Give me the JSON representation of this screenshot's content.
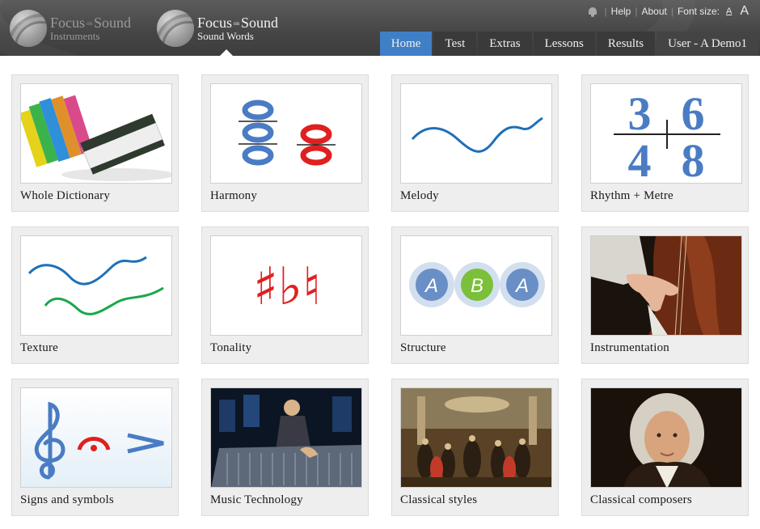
{
  "header": {
    "logo_instruments": {
      "brand": "Focus",
      "on": "on",
      "brand2": "Sound",
      "product": "Instruments"
    },
    "logo_words": {
      "brand": "Focus",
      "on": "on",
      "brand2": "Sound",
      "product": "Sound Words"
    },
    "links": {
      "help": "Help",
      "about": "About",
      "font_size": "Font size:",
      "font_small": "A",
      "font_large": "A"
    },
    "nav": [
      {
        "label": "Home",
        "active": true
      },
      {
        "label": "Test"
      },
      {
        "label": "Extras"
      },
      {
        "label": "Lessons"
      },
      {
        "label": "Results"
      },
      {
        "label": "User - A Demo1"
      }
    ]
  },
  "cards": [
    {
      "label": "Whole Dictionary",
      "icon": "books-icon"
    },
    {
      "label": "Harmony",
      "icon": "harmony-notes-icon"
    },
    {
      "label": "Melody",
      "icon": "melody-line-icon"
    },
    {
      "label": "Rhythm + Metre",
      "icon": "time-signature-icon",
      "numbers": [
        "3",
        "4",
        "6",
        "8"
      ]
    },
    {
      "label": "Texture",
      "icon": "texture-lines-icon"
    },
    {
      "label": "Tonality",
      "icon": "accidentals-icon",
      "glyphs": "♯♭♮"
    },
    {
      "label": "Structure",
      "icon": "aba-form-icon",
      "letters": [
        "A",
        "B",
        "A"
      ]
    },
    {
      "label": "Instrumentation",
      "icon": "double-bass-photo"
    },
    {
      "label": "Signs and symbols",
      "icon": "music-symbols-icon"
    },
    {
      "label": "Music Technology",
      "icon": "mixing-desk-photo"
    },
    {
      "label": "Classical styles",
      "icon": "baroque-painting"
    },
    {
      "label": "Classical composers",
      "icon": "bach-portrait"
    }
  ],
  "colors": {
    "nav_active": "#3f7fc6",
    "notes_blue": "#4a7cc4",
    "notes_red": "#e02020",
    "melody_blue": "#1f6fb8",
    "texture_green": "#18a84a",
    "form_green": "#7bbf3a"
  }
}
